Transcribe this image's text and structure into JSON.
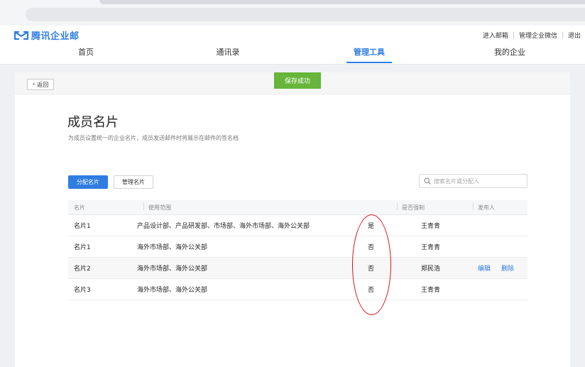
{
  "brand": {
    "name": "腾讯企业邮",
    "accent_color": "#2f7de1"
  },
  "top_links": [
    "进入邮箱",
    "管理企业微信",
    "退出"
  ],
  "nav": [
    {
      "label": "首页",
      "active": false
    },
    {
      "label": "通讯录",
      "active": false
    },
    {
      "label": "管理工具",
      "active": true
    },
    {
      "label": "我的企业",
      "active": false
    }
  ],
  "back_label": "返回",
  "toast": "保存成功",
  "page_title": "成员名片",
  "page_desc": "为成员设置统一的企业名片，成员发送邮件时将展示在邮件的签名档",
  "actions": {
    "assign": "分配名片",
    "manage": "管理名片"
  },
  "search": {
    "placeholder": "搜索名片或分配人",
    "value": ""
  },
  "table": {
    "columns": [
      "名片",
      "使用范围",
      "是否强制",
      "发布人"
    ],
    "rows": [
      {
        "card": "名片1",
        "scope": "产品设计部、产品研发部、市场部、海外市场部、海外公关部",
        "forced": "是",
        "publisher": "王青青"
      },
      {
        "card": "名片1",
        "scope": "海外市场部、海外公关部",
        "forced": "否",
        "publisher": "王青青"
      },
      {
        "card": "名片2",
        "scope": "海外市场部、海外公关部",
        "forced": "否",
        "publisher": "郑民浩",
        "edit": "编辑",
        "delete": "删除"
      },
      {
        "card": "名片3",
        "scope": "海外市场部、海外公关部",
        "forced": "否",
        "publisher": "王青青"
      }
    ]
  },
  "icons": {
    "logo": "tencent-mail-logo-icon",
    "back": "chevron-left-icon",
    "search": "search-icon"
  },
  "colors": {
    "toast_green": "#67b53b",
    "annotation_red": "#d8141a"
  }
}
